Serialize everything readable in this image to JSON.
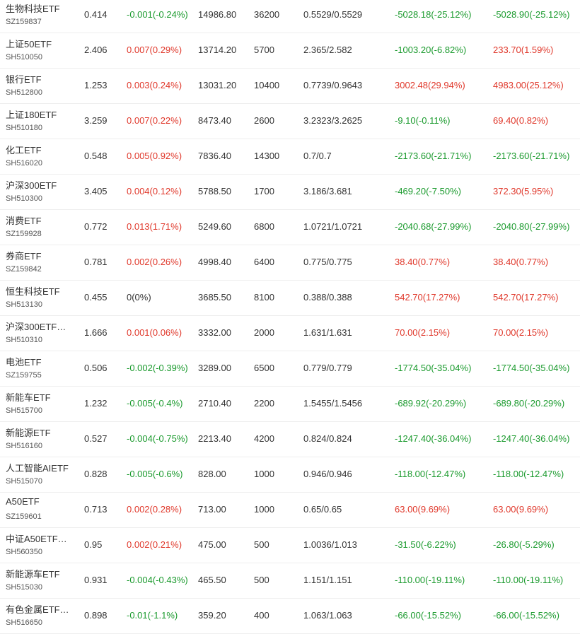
{
  "colors": {
    "up": "#e0382b",
    "down": "#1a9a2d",
    "flat": "#333333"
  },
  "rows": [
    {
      "name": "生物科技ETF",
      "code": "SZ159837",
      "price": "0.414",
      "change": "-0.001(-0.24%)",
      "change_dir": "down",
      "value": "14986.80",
      "qty": "36200",
      "cost": "0.5529/0.5529",
      "pl1": "-5028.18(-25.12%)",
      "pl1_dir": "down",
      "pl2": "-5028.90(-25.12%)",
      "pl2_dir": "down"
    },
    {
      "name": "上证50ETF",
      "code": "SH510050",
      "price": "2.406",
      "change": "0.007(0.29%)",
      "change_dir": "up",
      "value": "13714.20",
      "qty": "5700",
      "cost": "2.365/2.582",
      "pl1": "-1003.20(-6.82%)",
      "pl1_dir": "down",
      "pl2": "233.70(1.59%)",
      "pl2_dir": "up"
    },
    {
      "name": "银行ETF",
      "code": "SH512800",
      "price": "1.253",
      "change": "0.003(0.24%)",
      "change_dir": "up",
      "value": "13031.20",
      "qty": "10400",
      "cost": "0.7739/0.9643",
      "pl1": "3002.48(29.94%)",
      "pl1_dir": "up",
      "pl2": "4983.00(25.12%)",
      "pl2_dir": "up"
    },
    {
      "name": "上证180ETF",
      "code": "SH510180",
      "price": "3.259",
      "change": "0.007(0.22%)",
      "change_dir": "up",
      "value": "8473.40",
      "qty": "2600",
      "cost": "3.2323/3.2625",
      "pl1": "-9.10(-0.11%)",
      "pl1_dir": "down",
      "pl2": "69.40(0.82%)",
      "pl2_dir": "up"
    },
    {
      "name": "化工ETF",
      "code": "SH516020",
      "price": "0.548",
      "change": "0.005(0.92%)",
      "change_dir": "up",
      "value": "7836.40",
      "qty": "14300",
      "cost": "0.7/0.7",
      "pl1": "-2173.60(-21.71%)",
      "pl1_dir": "down",
      "pl2": "-2173.60(-21.71%)",
      "pl2_dir": "down"
    },
    {
      "name": "沪深300ETF",
      "code": "SH510300",
      "price": "3.405",
      "change": "0.004(0.12%)",
      "change_dir": "up",
      "value": "5788.50",
      "qty": "1700",
      "cost": "3.186/3.681",
      "pl1": "-469.20(-7.50%)",
      "pl1_dir": "down",
      "pl2": "372.30(5.95%)",
      "pl2_dir": "up"
    },
    {
      "name": "消费ETF",
      "code": "SZ159928",
      "price": "0.772",
      "change": "0.013(1.71%)",
      "change_dir": "up",
      "value": "5249.60",
      "qty": "6800",
      "cost": "1.0721/1.0721",
      "pl1": "-2040.68(-27.99%)",
      "pl1_dir": "down",
      "pl2": "-2040.80(-27.99%)",
      "pl2_dir": "down"
    },
    {
      "name": "券商ETF",
      "code": "SZ159842",
      "price": "0.781",
      "change": "0.002(0.26%)",
      "change_dir": "up",
      "value": "4998.40",
      "qty": "6400",
      "cost": "0.775/0.775",
      "pl1": "38.40(0.77%)",
      "pl1_dir": "up",
      "pl2": "38.40(0.77%)",
      "pl2_dir": "up"
    },
    {
      "name": "恒生科技ETF",
      "code": "SH513130",
      "price": "0.455",
      "change": "0(0%)",
      "change_dir": "flat",
      "value": "3685.50",
      "qty": "8100",
      "cost": "0.388/0.388",
      "pl1": "542.70(17.27%)",
      "pl1_dir": "up",
      "pl2": "542.70(17.27%)",
      "pl2_dir": "up"
    },
    {
      "name": "沪深300ETF…",
      "code": "SH510310",
      "price": "1.666",
      "change": "0.001(0.06%)",
      "change_dir": "up",
      "value": "3332.00",
      "qty": "2000",
      "cost": "1.631/1.631",
      "pl1": "70.00(2.15%)",
      "pl1_dir": "up",
      "pl2": "70.00(2.15%)",
      "pl2_dir": "up"
    },
    {
      "name": "电池ETF",
      "code": "SZ159755",
      "price": "0.506",
      "change": "-0.002(-0.39%)",
      "change_dir": "down",
      "value": "3289.00",
      "qty": "6500",
      "cost": "0.779/0.779",
      "pl1": "-1774.50(-35.04%)",
      "pl1_dir": "down",
      "pl2": "-1774.50(-35.04%)",
      "pl2_dir": "down"
    },
    {
      "name": "新能车ETF",
      "code": "SH515700",
      "price": "1.232",
      "change": "-0.005(-0.4%)",
      "change_dir": "down",
      "value": "2710.40",
      "qty": "2200",
      "cost": "1.5455/1.5456",
      "pl1": "-689.92(-20.29%)",
      "pl1_dir": "down",
      "pl2": "-689.80(-20.29%)",
      "pl2_dir": "down"
    },
    {
      "name": "新能源ETF",
      "code": "SH516160",
      "price": "0.527",
      "change": "-0.004(-0.75%)",
      "change_dir": "down",
      "value": "2213.40",
      "qty": "4200",
      "cost": "0.824/0.824",
      "pl1": "-1247.40(-36.04%)",
      "pl1_dir": "down",
      "pl2": "-1247.40(-36.04%)",
      "pl2_dir": "down"
    },
    {
      "name": "人工智能AIETF",
      "code": "SH515070",
      "price": "0.828",
      "change": "-0.005(-0.6%)",
      "change_dir": "down",
      "value": "828.00",
      "qty": "1000",
      "cost": "0.946/0.946",
      "pl1": "-118.00(-12.47%)",
      "pl1_dir": "down",
      "pl2": "-118.00(-12.47%)",
      "pl2_dir": "down"
    },
    {
      "name": "A50ETF",
      "code": "SZ159601",
      "price": "0.713",
      "change": "0.002(0.28%)",
      "change_dir": "up",
      "value": "713.00",
      "qty": "1000",
      "cost": "0.65/0.65",
      "pl1": "63.00(9.69%)",
      "pl1_dir": "up",
      "pl2": "63.00(9.69%)",
      "pl2_dir": "up"
    },
    {
      "name": "中证A50ETF…",
      "code": "SH560350",
      "price": "0.95",
      "change": "0.002(0.21%)",
      "change_dir": "up",
      "value": "475.00",
      "qty": "500",
      "cost": "1.0036/1.013",
      "pl1": "-31.50(-6.22%)",
      "pl1_dir": "down",
      "pl2": "-26.80(-5.29%)",
      "pl2_dir": "down"
    },
    {
      "name": "新能源车ETF",
      "code": "SH515030",
      "price": "0.931",
      "change": "-0.004(-0.43%)",
      "change_dir": "down",
      "value": "465.50",
      "qty": "500",
      "cost": "1.151/1.151",
      "pl1": "-110.00(-19.11%)",
      "pl1_dir": "down",
      "pl2": "-110.00(-19.11%)",
      "pl2_dir": "down"
    },
    {
      "name": "有色金属ETF…",
      "code": "SH516650",
      "price": "0.898",
      "change": "-0.01(-1.1%)",
      "change_dir": "down",
      "value": "359.20",
      "qty": "400",
      "cost": "1.063/1.063",
      "pl1": "-66.00(-15.52%)",
      "pl1_dir": "down",
      "pl2": "-66.00(-15.52%)",
      "pl2_dir": "down"
    }
  ]
}
